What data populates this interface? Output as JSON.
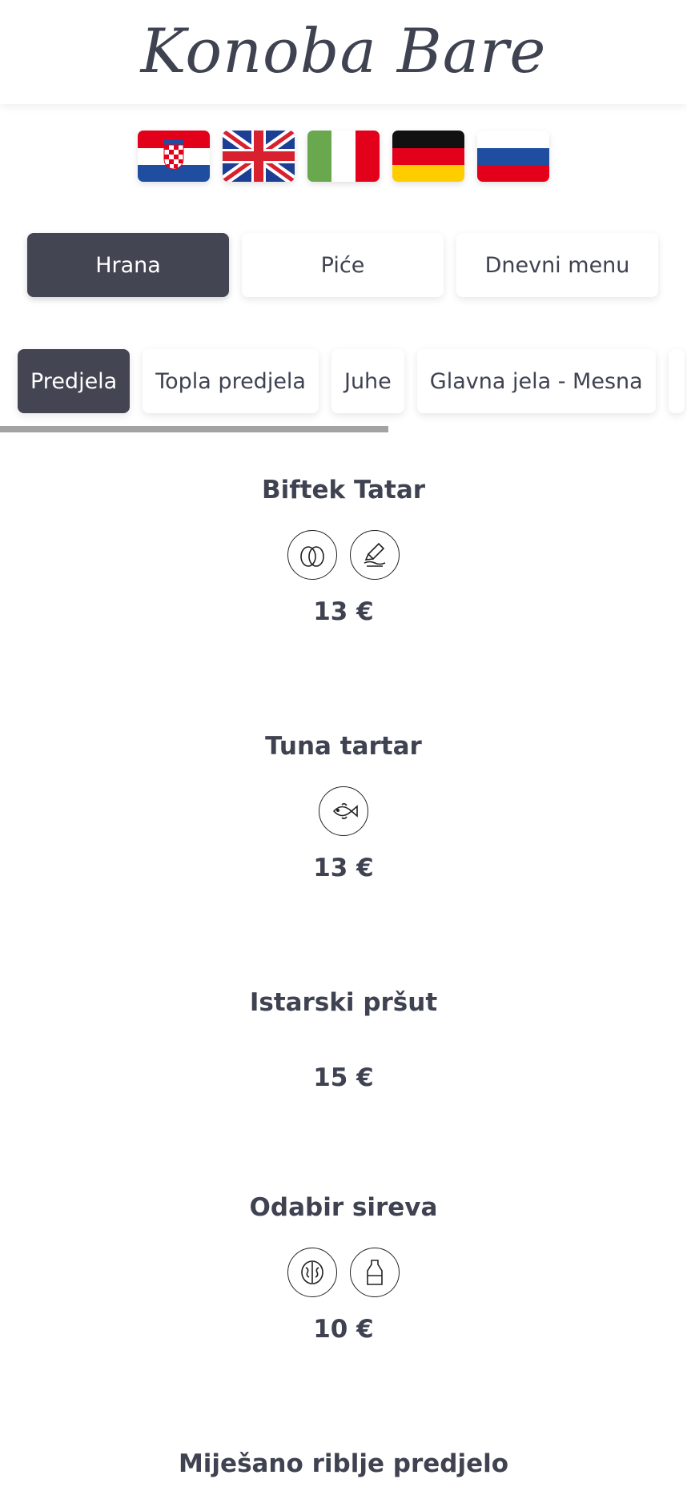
{
  "header": {
    "title": "Konoba Bare"
  },
  "languages": [
    {
      "code": "hr",
      "icon": "croatia-flag-icon"
    },
    {
      "code": "en",
      "icon": "uk-flag-icon"
    },
    {
      "code": "it",
      "icon": "italy-flag-icon"
    },
    {
      "code": "de",
      "icon": "germany-flag-icon"
    },
    {
      "code": "ru",
      "icon": "russia-flag-icon"
    }
  ],
  "main_tabs": [
    {
      "label": "Hrana",
      "active": true
    },
    {
      "label": "Piće",
      "active": false
    },
    {
      "label": "Dnevni menu",
      "active": false
    }
  ],
  "categories": [
    {
      "label": "Predjela",
      "active": true
    },
    {
      "label": "Topla predjela",
      "active": false
    },
    {
      "label": "Juhe",
      "active": false
    },
    {
      "label": "Glavna jela - Mesna",
      "active": false
    }
  ],
  "items": [
    {
      "name": "Biftek Tatar",
      "allergens": [
        "egg-icon",
        "mustard-icon"
      ],
      "price": "13 €"
    },
    {
      "name": "Tuna tartar",
      "allergens": [
        "fish-icon"
      ],
      "price": "13 €"
    },
    {
      "name": "Istarski pršut",
      "allergens": [],
      "price": "15 €"
    },
    {
      "name": "Odabir sireva",
      "allergens": [
        "nuts-icon",
        "milk-icon"
      ],
      "price": "10 €"
    },
    {
      "name": "Miješano riblje predjelo",
      "allergens": [],
      "price": ""
    }
  ],
  "colors": {
    "accent": "#434552",
    "text": "#3f4250",
    "scrollbar": "#a3a3a3"
  }
}
